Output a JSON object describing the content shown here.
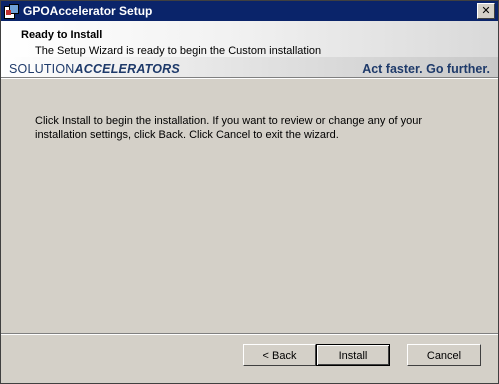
{
  "window": {
    "title": "GPOAccelerator Setup",
    "close_label": "✕"
  },
  "banner": {
    "heading": "Ready to Install",
    "description": "The Setup Wizard is ready to begin the Custom installation",
    "logo_part1": "SOLUTION",
    "logo_part2": "ACCELERATORS",
    "tagline": "Act faster. Go further."
  },
  "main": {
    "message": "Click Install to begin the installation. If you want to review or change any of your installation settings, click Back. Click Cancel to exit the wizard."
  },
  "buttons": {
    "back": "< Back",
    "install": "Install",
    "cancel": "Cancel"
  },
  "icons": {
    "app": "setup-app-icon",
    "close": "close-icon"
  }
}
